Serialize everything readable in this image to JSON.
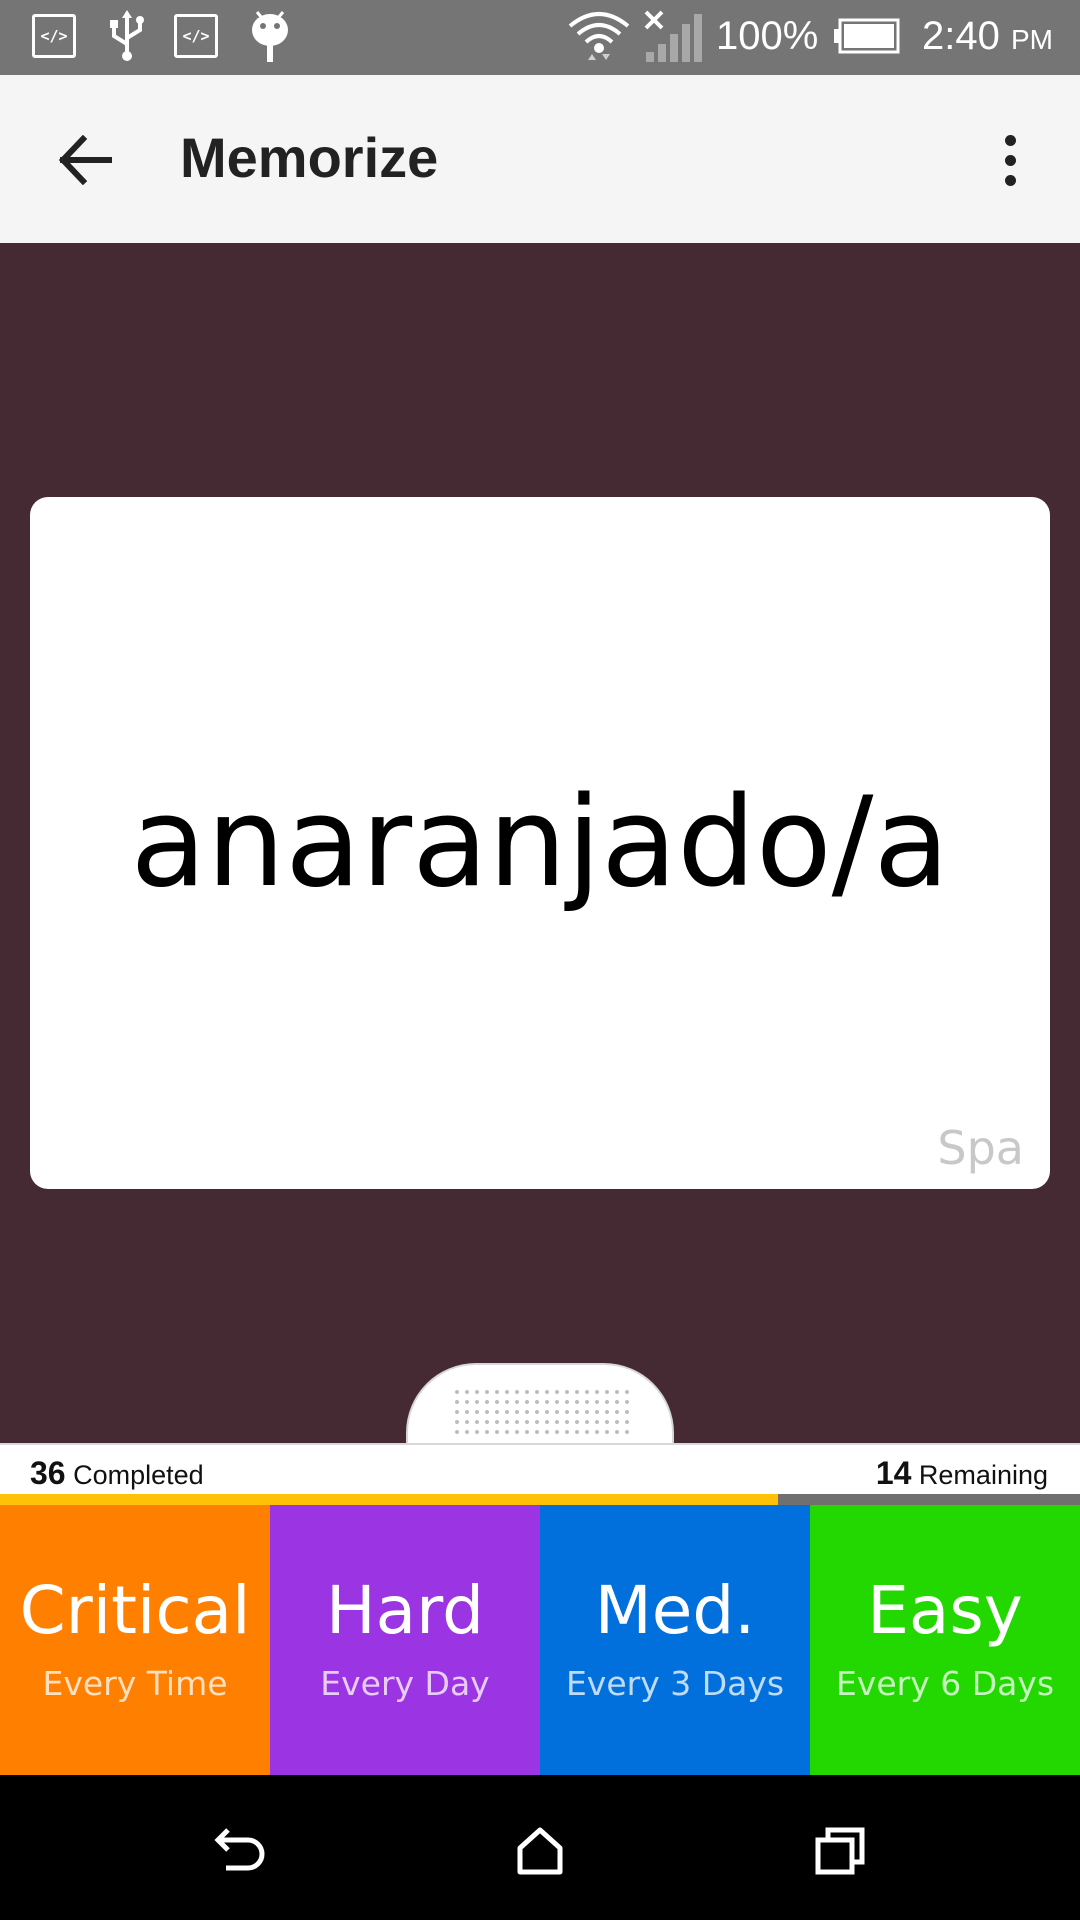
{
  "status_bar": {
    "battery": "100%",
    "time": "2:40",
    "time_suffix": "PM",
    "icons": [
      "code-icon",
      "usb-icon",
      "code-icon",
      "android-icon",
      "wifi-icon",
      "signal-icon",
      "battery-icon"
    ]
  },
  "app_bar": {
    "title": "Memorize",
    "back_icon": "arrow-back-icon",
    "menu_icon": "more-vert-icon"
  },
  "card": {
    "word": "anaranjado/a",
    "language": "Spa"
  },
  "progress": {
    "completed_count": "36",
    "completed_label": "Completed",
    "remaining_count": "14",
    "remaining_label": "Remaining",
    "fraction": 0.72
  },
  "ratings": [
    {
      "label": "Critical",
      "sub": "Every Time",
      "color": "#ff8000"
    },
    {
      "label": "Hard",
      "sub": "Every Day",
      "color": "#9b34e2"
    },
    {
      "label": "Med.",
      "sub": "Every 3 Days",
      "color": "#0170dd"
    },
    {
      "label": "Easy",
      "sub": "Every 6 Days",
      "color": "#22d800"
    }
  ],
  "colors": {
    "background": "#452a34",
    "status_bar": "#757575",
    "app_bar": "#f5f5f5",
    "progress_fill": "#ffc107",
    "progress_track": "#707070"
  },
  "nav_bar": {
    "icons": [
      "back-nav-icon",
      "home-nav-icon",
      "recents-nav-icon"
    ]
  }
}
